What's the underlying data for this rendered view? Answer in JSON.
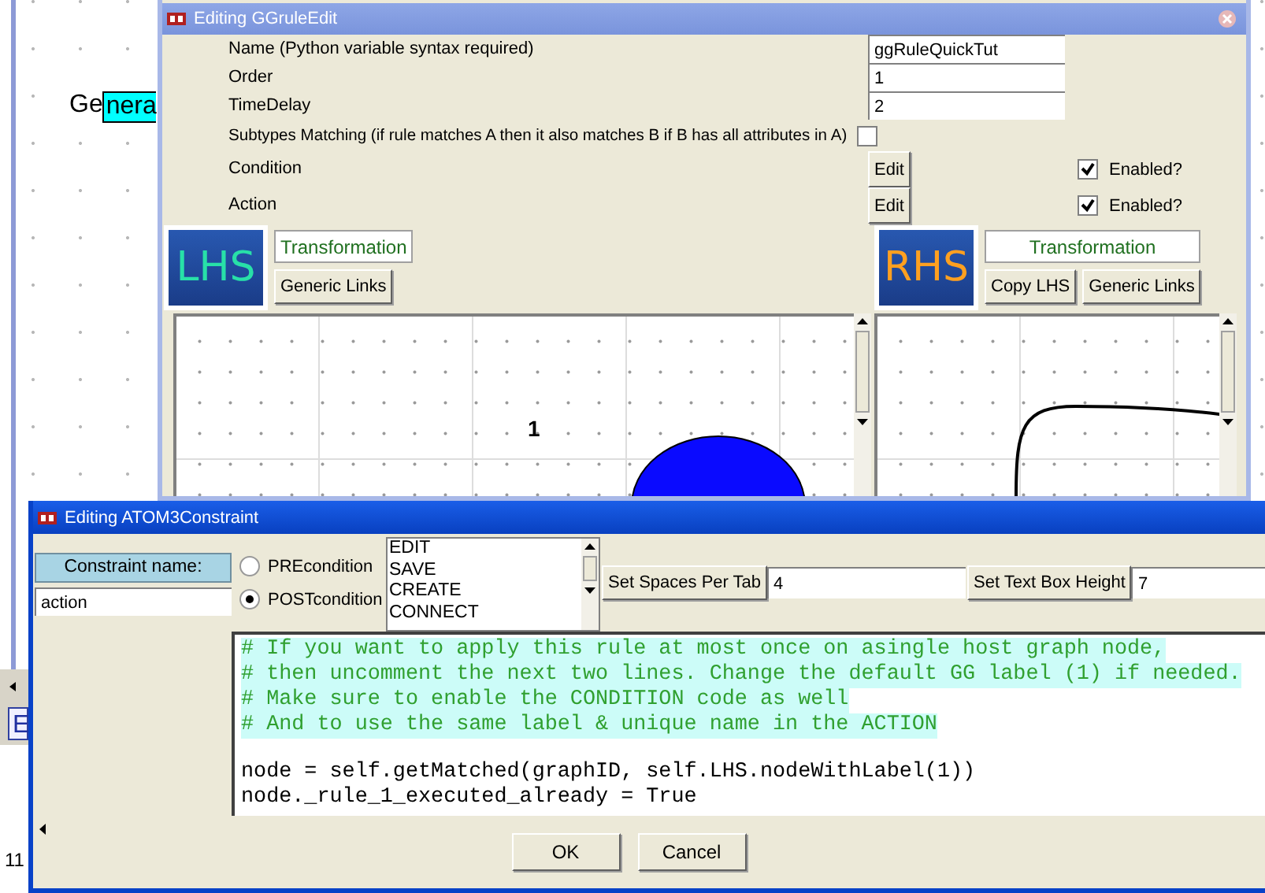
{
  "background": {
    "label_plain": "Ge",
    "label_highlighted": "nera",
    "button_fragment": "E",
    "number_fragment": "11"
  },
  "rule_window": {
    "title": "Editing GGruleEdit",
    "fields": [
      {
        "label": "Name (Python variable syntax required)",
        "value": "ggRuleQuickTut"
      },
      {
        "label": "Order",
        "value": "1"
      },
      {
        "label": "TimeDelay",
        "value": "2"
      }
    ],
    "subtypes": {
      "label": "Subtypes Matching (if rule matches A then it also matches B if B has all attributes in A)",
      "checked": false
    },
    "code_rows": [
      {
        "label": "Condition",
        "button": "Edit",
        "enabled_label": "Enabled?",
        "checked": true
      },
      {
        "label": "Action",
        "button": "Edit",
        "enabled_label": "Enabled?",
        "checked": true
      }
    ],
    "sides": [
      {
        "kind": "lhs",
        "logo": "LHS",
        "name": "Transformation",
        "buttons": [
          "Generic Links"
        ],
        "node_label": "1"
      },
      {
        "kind": "rhs",
        "logo": "RHS",
        "name": "Transformation",
        "buttons": [
          "Copy LHS",
          "Generic Links"
        ]
      }
    ]
  },
  "constraint_window": {
    "title": "Editing ATOM3Constraint",
    "name_label": "Constraint name:",
    "name_value": "action",
    "conditions": [
      {
        "label": "PREcondition",
        "selected": false
      },
      {
        "label": "POSTcondition",
        "selected": true
      }
    ],
    "events": [
      "EDIT",
      "SAVE",
      "CREATE",
      "CONNECT"
    ],
    "settings": [
      {
        "button": "Set Spaces Per Tab",
        "value": "4"
      },
      {
        "button": "Set Text Box Height",
        "value": "7"
      }
    ],
    "code": [
      {
        "kind": "comment",
        "text": "# If you want to apply this rule at most once on asingle host graph node,"
      },
      {
        "kind": "comment",
        "text": "# then uncomment the next two lines. Change the default GG label (1) if needed."
      },
      {
        "kind": "comment",
        "text": "# Make sure to enable the CONDITION code as well"
      },
      {
        "kind": "comment",
        "text": "# And to use the same label & unique name in the ACTION"
      },
      {
        "kind": "blank"
      },
      {
        "kind": "code",
        "text": "node = self.getMatched(graphID, self.LHS.nodeWithLabel(1))"
      },
      {
        "kind": "code",
        "text": "node._rule_1_executed_already = True"
      }
    ],
    "buttons": [
      "OK",
      "Cancel"
    ]
  }
}
